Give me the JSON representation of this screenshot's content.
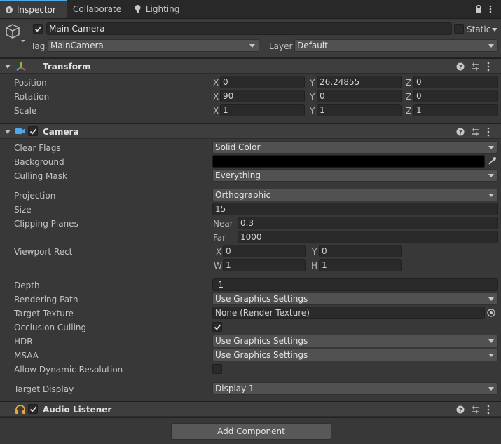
{
  "tabs": [
    {
      "label": "Inspector",
      "icon": "info-icon",
      "active": true
    },
    {
      "label": "Collaborate",
      "active": false
    },
    {
      "label": "Lighting",
      "icon": "lightbulb-icon",
      "active": false
    }
  ],
  "object": {
    "name": "Main Camera",
    "static_label": "Static",
    "tag_label": "Tag",
    "tag_value": "MainCamera",
    "layer_label": "Layer",
    "layer_value": "Default"
  },
  "transform": {
    "title": "Transform",
    "position_label": "Position",
    "rotation_label": "Rotation",
    "scale_label": "Scale",
    "position": {
      "x": "0",
      "y": "26.24855",
      "z": "0"
    },
    "rotation": {
      "x": "90",
      "y": "0",
      "z": "0"
    },
    "scale": {
      "x": "1",
      "y": "1",
      "z": "1"
    }
  },
  "axis_labels": {
    "x": "X",
    "y": "Y",
    "z": "Z",
    "w": "W",
    "h": "H"
  },
  "camera": {
    "title": "Camera",
    "clear_flags_label": "Clear Flags",
    "clear_flags_value": "Solid Color",
    "background_label": "Background",
    "background_color": "#000000",
    "culling_mask_label": "Culling Mask",
    "culling_mask_value": "Everything",
    "projection_label": "Projection",
    "projection_value": "Orthographic",
    "size_label": "Size",
    "size_value": "15",
    "clipping_label": "Clipping Planes",
    "near_label": "Near",
    "near_value": "0.3",
    "far_label": "Far",
    "far_value": "1000",
    "viewport_label": "Viewport Rect",
    "viewport": {
      "x": "0",
      "y": "0",
      "w": "1",
      "h": "1"
    },
    "depth_label": "Depth",
    "depth_value": "-1",
    "rendering_path_label": "Rendering Path",
    "rendering_path_value": "Use Graphics Settings",
    "target_texture_label": "Target Texture",
    "target_texture_value": "None (Render Texture)",
    "occlusion_label": "Occlusion Culling",
    "occlusion_checked": true,
    "hdr_label": "HDR",
    "hdr_value": "Use Graphics Settings",
    "msaa_label": "MSAA",
    "msaa_value": "Use Graphics Settings",
    "dynamic_res_label": "Allow Dynamic Resolution",
    "dynamic_res_checked": false,
    "target_display_label": "Target Display",
    "target_display_value": "Display 1"
  },
  "audio_listener": {
    "title": "Audio Listener"
  },
  "add_component_label": "Add Component",
  "colors": {
    "accent_blue": "#4fa9e8",
    "panel": "#383838",
    "header": "#3e3e3e"
  }
}
